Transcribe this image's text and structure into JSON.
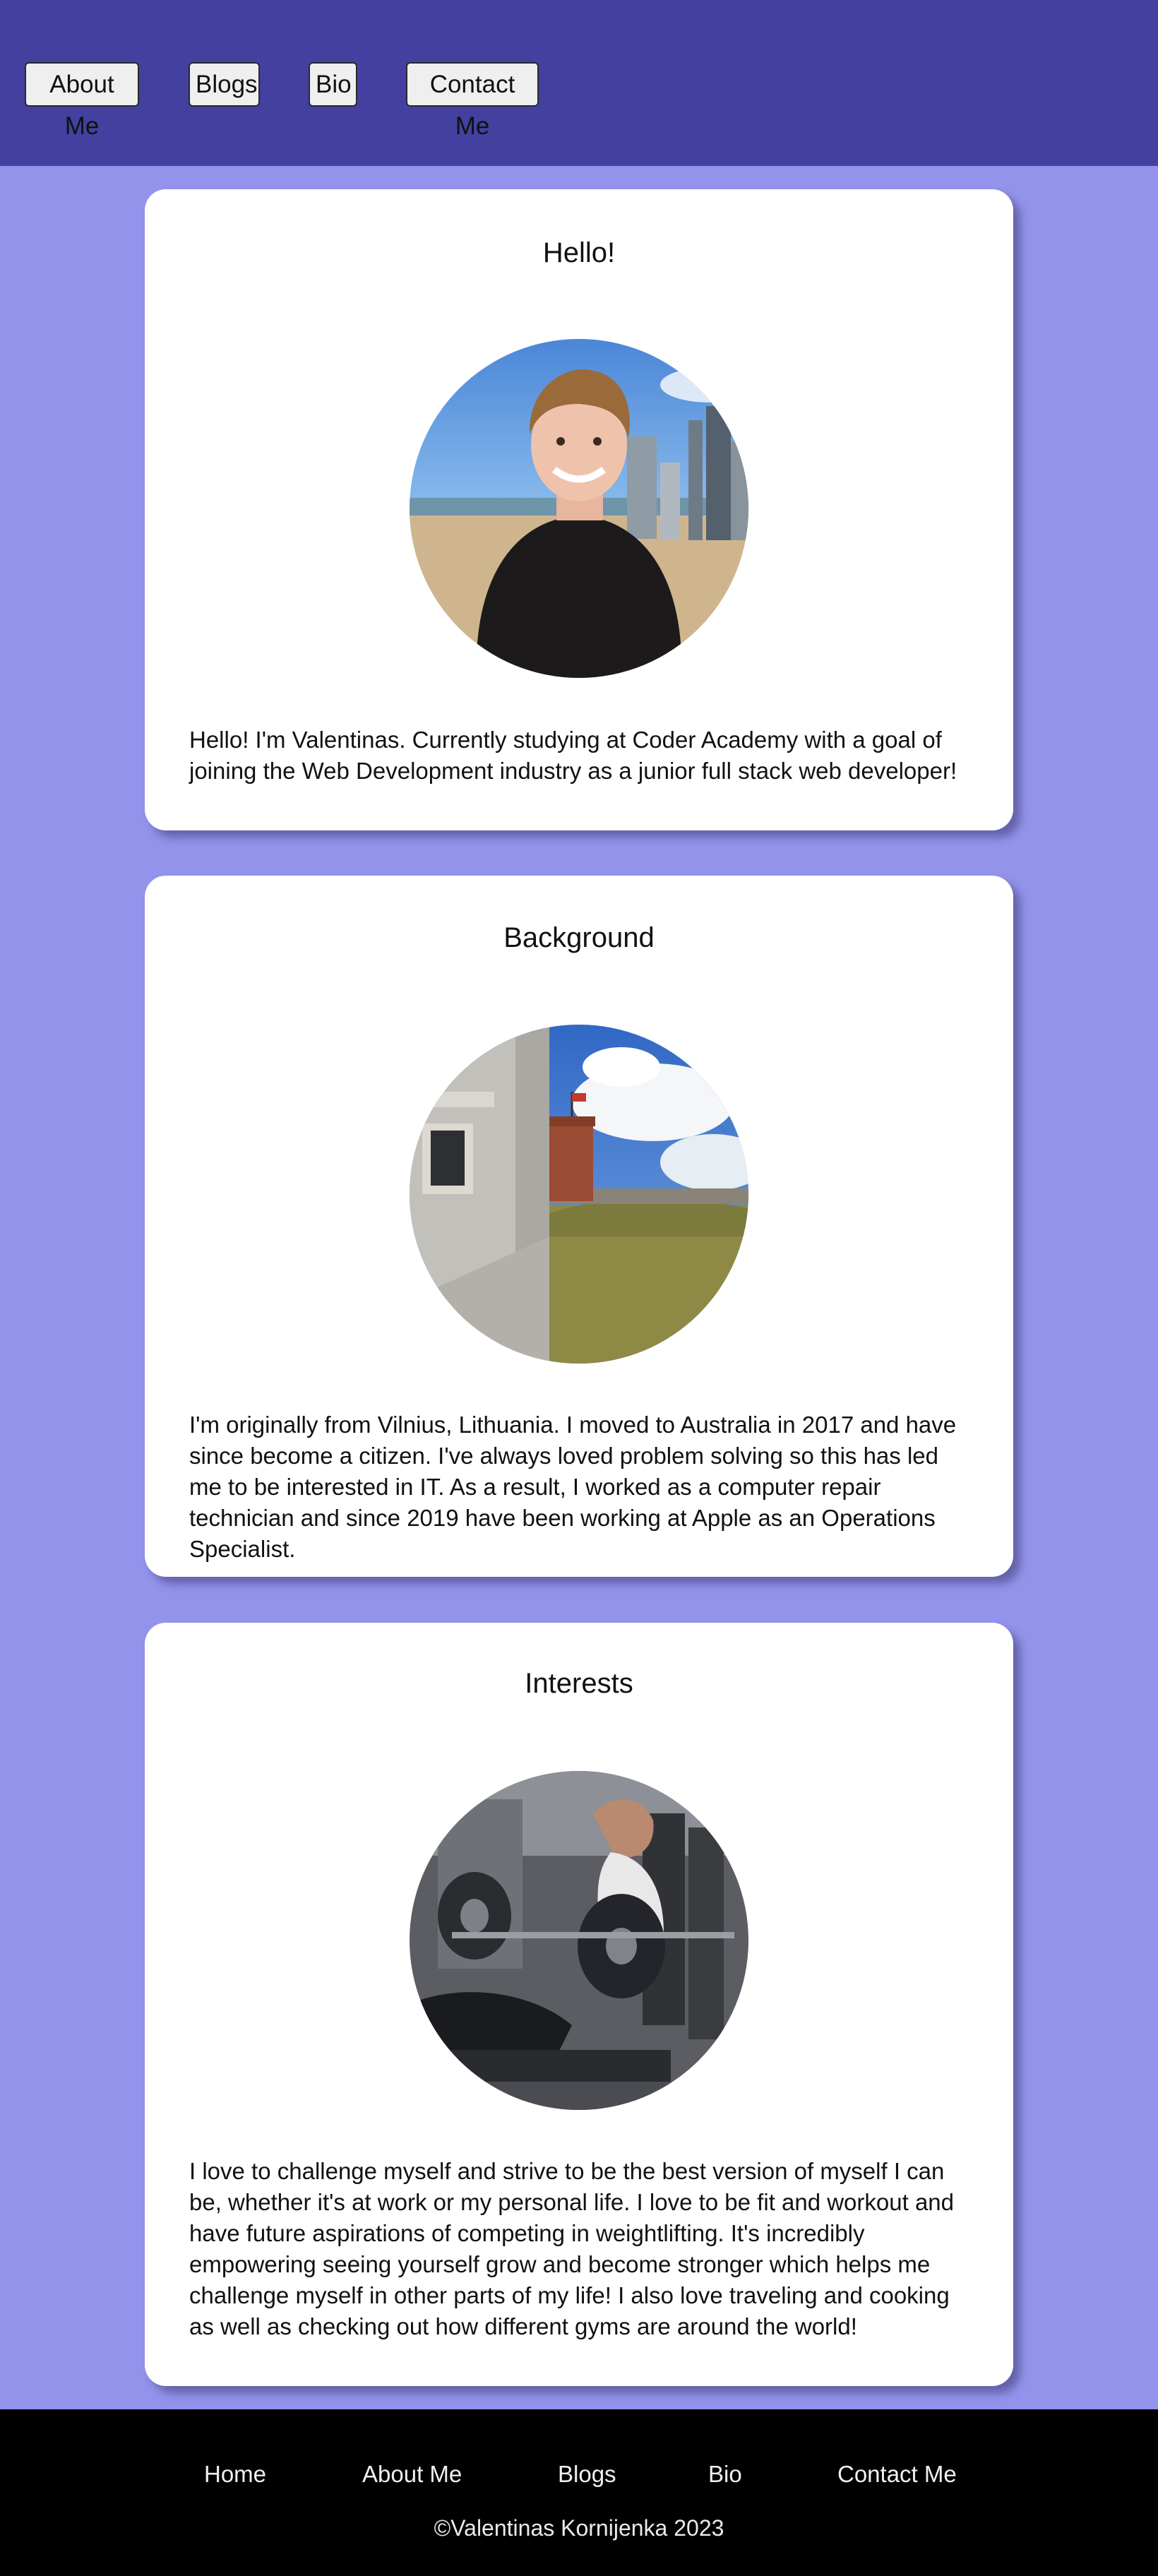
{
  "nav": {
    "items": [
      "About Me",
      "Blogs",
      "Bio",
      "Contact Me"
    ]
  },
  "cards": [
    {
      "title": "Hello!",
      "image": "profile-photo",
      "text": "Hello! I'm Valentinas. Currently studying at Coder Academy with a goal of joining the Web Development industry as a junior full stack web developer!"
    },
    {
      "title": "Background",
      "image": "castle-photo",
      "text": "I'm originally from Vilnius, Lithuania. I moved to Australia in 2017 and have since become a citizen. I've always loved problem solving so this has led me to be interested in IT. As a result, I worked as a computer repair technician and since 2019 have been working at Apple as an Operations Specialist."
    },
    {
      "title": "Interests",
      "image": "gym-photo",
      "text": "I love to challenge myself and strive to be the best version of myself I can be, whether it's at work or my personal life. I love to be fit and workout and have future aspirations of competing in weightlifting. It's incredibly empowering seeing yourself grow and become stronger which helps me challenge myself in other parts of my life! I also love traveling and cooking as well as checking out how different gyms are around the world!"
    }
  ],
  "footer": {
    "links": [
      "Home",
      "About Me",
      "Blogs",
      "Bio",
      "Contact Me"
    ],
    "copyright": "©Valentinas Kornijenka 2023"
  },
  "colors": {
    "page_background": "#9393ec",
    "header_background": "#4340a0",
    "card_background": "#ffffff",
    "footer_background": "#000000"
  }
}
